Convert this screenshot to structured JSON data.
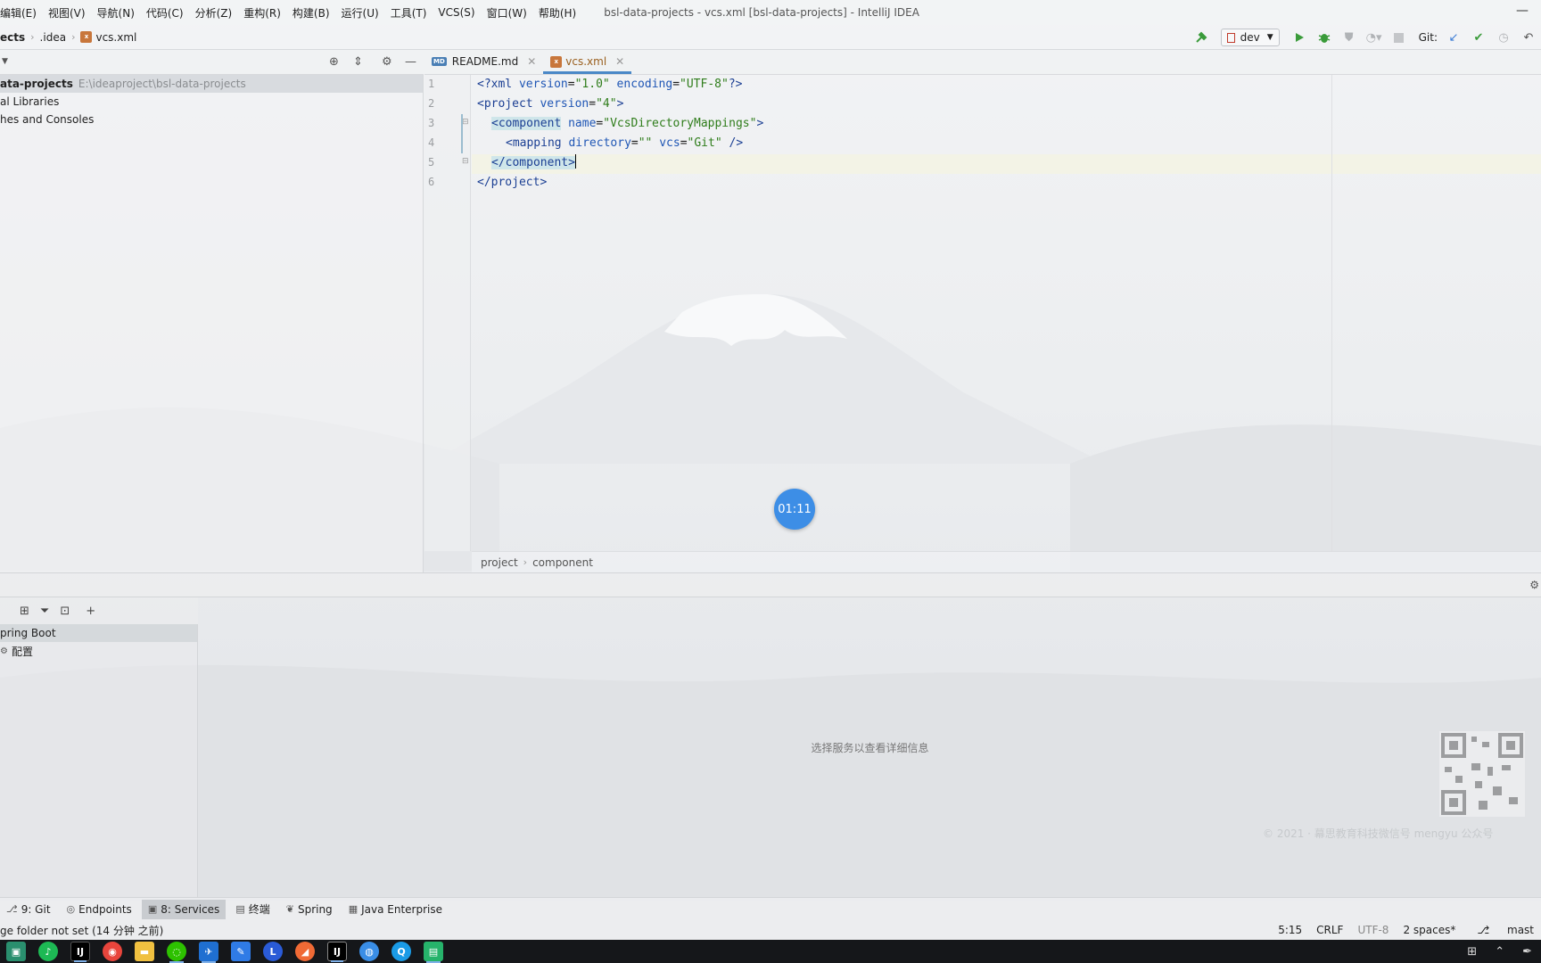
{
  "menubar": {
    "items": [
      "编辑(E)",
      "视图(V)",
      "导航(N)",
      "代码(C)",
      "分析(Z)",
      "重构(R)",
      "构建(B)",
      "运行(U)",
      "工具(T)",
      "VCS(S)",
      "窗口(W)",
      "帮助(H)"
    ],
    "title": "bsl-data-projects - vcs.xml [bsl-data-projects] - IntelliJ IDEA"
  },
  "navbar": {
    "crumbs": [
      "ects",
      ".idea",
      "vcs.xml"
    ],
    "run_config": "dev",
    "git_label": "Git:"
  },
  "project_tree": {
    "rows": [
      {
        "label": "ata-projects",
        "path": "E:\\ideaproject\\bsl-data-projects"
      },
      {
        "label": "al Libraries",
        "path": ""
      },
      {
        "label": "hes and Consoles",
        "path": ""
      }
    ]
  },
  "editor": {
    "tabs": [
      {
        "label": "README.md",
        "icon": "MD"
      },
      {
        "label": "vcs.xml",
        "icon": "XML"
      }
    ],
    "line_numbers": [
      "1",
      "2",
      "3",
      "4",
      "5",
      "6"
    ],
    "lines": {
      "l1_a": "<?xml ",
      "l1_b": "version",
      "l1_c": "=",
      "l1_d": "\"1.0\"",
      "l1_e": " encoding",
      "l1_f": "=",
      "l1_g": "\"UTF-8\"",
      "l1_h": "?>",
      "l2_a": "<project ",
      "l2_b": "version",
      "l2_c": "=",
      "l2_d": "\"4\"",
      "l2_e": ">",
      "l3_a": "<component",
      "l3_b": " name",
      "l3_c": "=",
      "l3_d": "\"VcsDirectoryMappings\"",
      "l3_e": ">",
      "l4_a": "<mapping ",
      "l4_b": "directory",
      "l4_c": "=",
      "l4_d": "\"\"",
      "l4_e": " vcs",
      "l4_f": "=",
      "l4_g": "\"Git\"",
      "l4_h": " />",
      "l5_a": "</component>",
      "l6_a": "</project>"
    },
    "breadcrumb": [
      "project",
      "component"
    ],
    "timer": "01:11"
  },
  "services": {
    "tree": [
      "pring Boot",
      "配置"
    ],
    "empty_message": "选择服务以查看详细信息"
  },
  "watermark": "© 2021 · 幕思教育科技微信号 mengyu 公众号",
  "tool_tabs": [
    {
      "label": "9: Git",
      "icon": "git-branch-icon"
    },
    {
      "label": "Endpoints",
      "icon": "endpoints-icon"
    },
    {
      "label": "8: Services",
      "icon": "services-icon"
    },
    {
      "label": "终端",
      "icon": "terminal-icon"
    },
    {
      "label": "Spring",
      "icon": "spring-icon"
    },
    {
      "label": "Java Enterprise",
      "icon": "java-enterprise-icon"
    }
  ],
  "statusbar": {
    "message": "ge folder not set (14 分钟 之前)",
    "position": "5:15",
    "line_sep": "CRLF",
    "encoding": "UTF-8",
    "indent": "2 spaces*",
    "branch": "mast"
  },
  "colors": {
    "accent": "#4a88c7",
    "run_green": "#3a9b3a",
    "timer_blue": "#3d8ee6"
  }
}
